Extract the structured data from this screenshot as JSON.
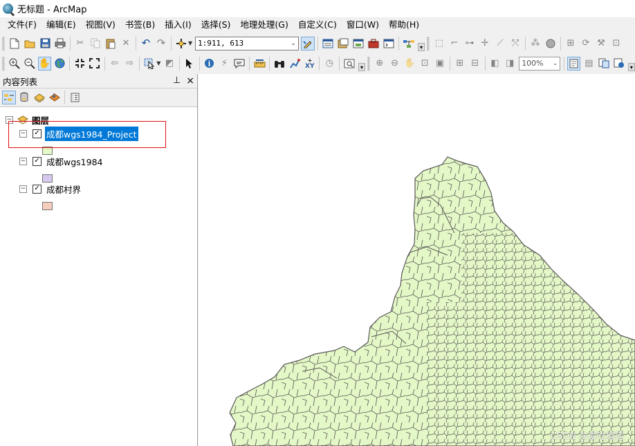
{
  "window": {
    "title": "无标题 - ArcMap"
  },
  "menu": [
    "文件(F)",
    "编辑(E)",
    "视图(V)",
    "书签(B)",
    "插入(I)",
    "选择(S)",
    "地理处理(G)",
    "自定义(C)",
    "窗口(W)",
    "帮助(H)"
  ],
  "toolbar": {
    "scale_value": "1:911, 613",
    "zoom_value": "100%"
  },
  "toc": {
    "title": "内容列表",
    "pin_glyph": "ᵱ",
    "close_glyph": "×",
    "root_label": "图层",
    "layers": [
      {
        "name": "成都wgs1984_Project",
        "visible": true,
        "selected": true,
        "swatch_color": "#e4f7c6"
      },
      {
        "name": "成都wgs1984",
        "visible": true,
        "selected": false,
        "swatch_color": "#d7c8ee"
      },
      {
        "name": "成都村界",
        "visible": true,
        "selected": false,
        "swatch_color": "#f5cdbd"
      }
    ]
  },
  "map": {
    "fill_color": "#e4f7c6",
    "stroke_color": "#555555",
    "watermark": "CSDN @爱吃榴莲"
  }
}
